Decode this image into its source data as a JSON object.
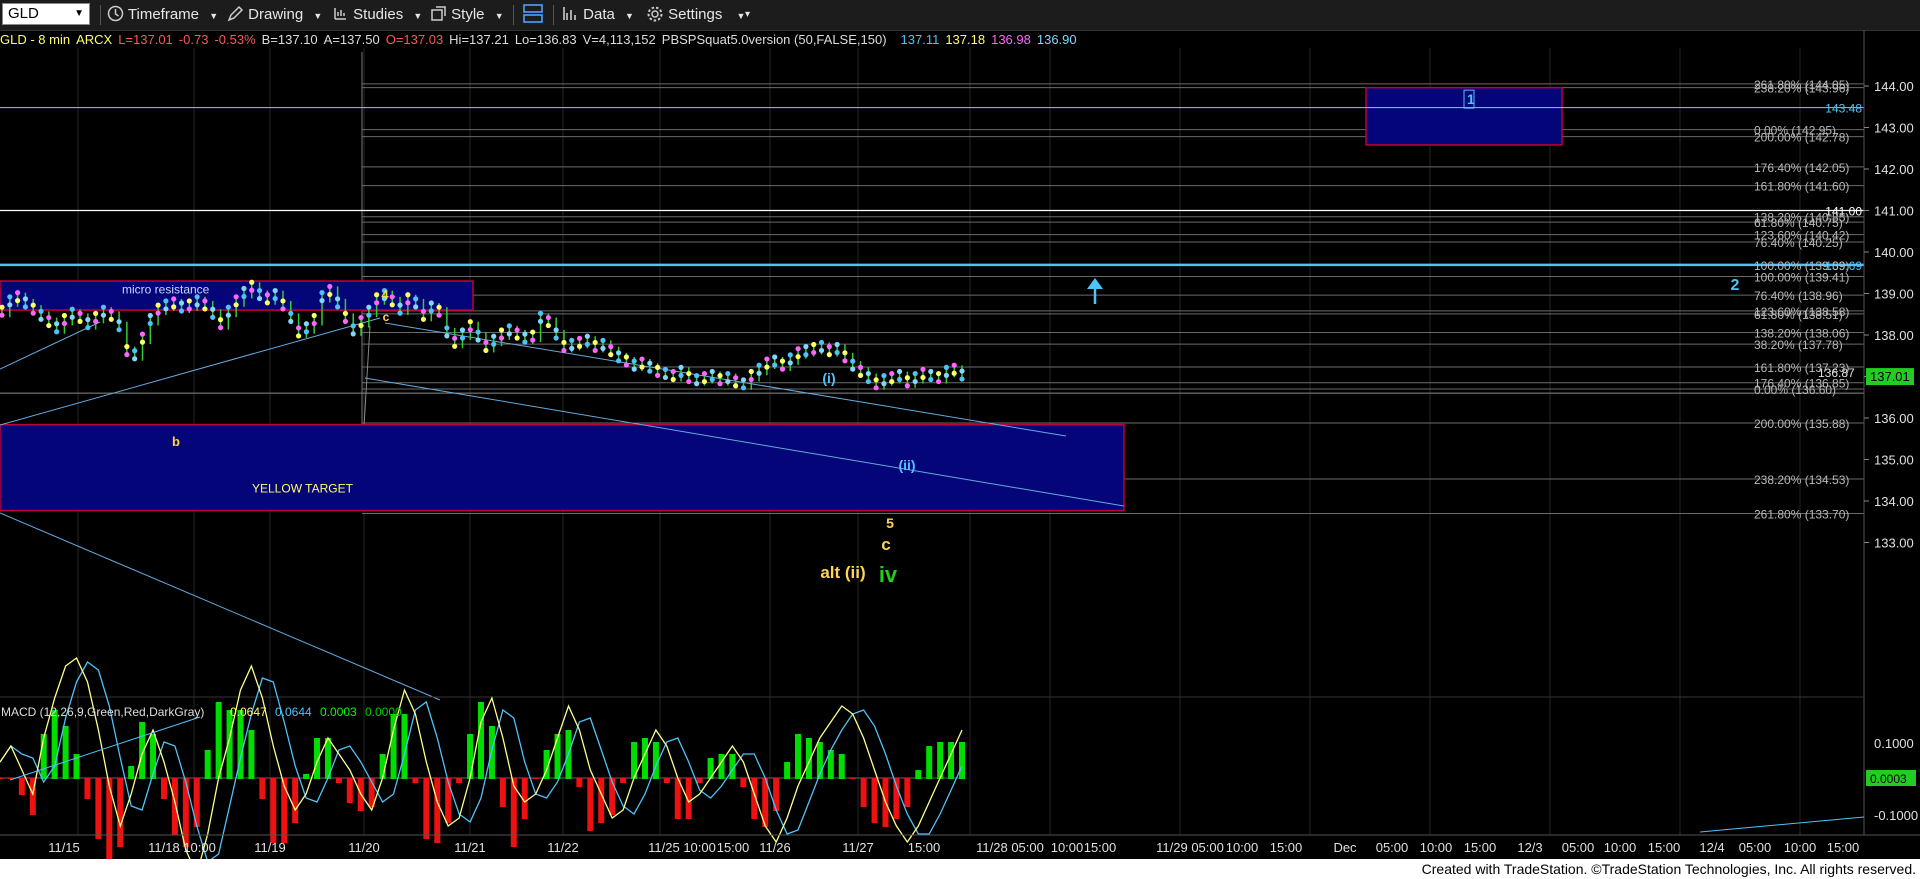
{
  "toolbar": {
    "symbol": "GLD",
    "timeframe": "Timeframe",
    "drawing": "Drawing",
    "studies": "Studies",
    "style": "Style",
    "data": "Data",
    "settings": "Settings"
  },
  "infobar": {
    "symbol": "GLD - 8 min",
    "exchange": "ARCX",
    "last": "L=137.01",
    "change": "-0.73",
    "change_pct": "-0.53%",
    "bid": "B=137.10",
    "ask": "A=137.50",
    "open": "O=137.03",
    "high": "Hi=137.21",
    "low": "Lo=136.83",
    "volume": "V=4,113,152",
    "study": "PBSPSquat5.0version (50,FALSE,150)",
    "study_vals": [
      {
        "text": "137.11",
        "color": "#4fc3f7"
      },
      {
        "text": "137.18",
        "color": "#ffff66"
      },
      {
        "text": "136.98",
        "color": "#ff66ff"
      },
      {
        "text": "136.90",
        "color": "#80d8ff"
      }
    ]
  },
  "macd": {
    "label": "MACD (12,26,9,Green,Red,DarkGray)",
    "vals": [
      {
        "text": "0.0647",
        "color": "#ffff66"
      },
      {
        "text": "0.0644",
        "color": "#4fc3f7"
      },
      {
        "text": "0.0003",
        "color": "#00ff00"
      },
      {
        "text": "0.0000",
        "color": "#00cc00"
      }
    ],
    "axis": [
      "0.1000",
      "-0.1000"
    ],
    "current": "0.0003"
  },
  "chart_data": {
    "type": "candlestick",
    "y_axis": {
      "min": 132.5,
      "max": 144.3,
      "ticks": [
        144.0,
        143.0,
        142.0,
        141.0,
        140.0,
        139.0,
        138.0,
        137.0,
        136.0,
        135.0,
        134.0,
        133.0
      ]
    },
    "x_labels": [
      "11/15",
      "11/18 10:00",
      "11/19",
      "11/20",
      "11/21",
      "11/22",
      "11/25 10:00",
      "15:00",
      "11/26",
      "11/27",
      "15:00",
      "11/28 05:00",
      "10:00",
      "15:00",
      "11/29 05:00",
      "10:00",
      "15:00",
      "Dec",
      "05:00",
      "10:00",
      "15:00",
      "12/3",
      "05:00",
      "10:00",
      "15:00",
      "12/4",
      "05:00",
      "10:00",
      "15:00"
    ],
    "last_price": "137.01",
    "marked_price": "136.87",
    "horizontal_levels": [
      {
        "label": "143.48",
        "value": 143.48,
        "color": "#4fc3f7"
      },
      {
        "label": "141.00",
        "value": 141.0,
        "color": "#ffffff"
      },
      {
        "label": "139.69",
        "value": 139.69,
        "color": "#4fc3f7"
      }
    ],
    "fib_labels": [
      {
        "text": "261.80% (144.05)",
        "value": 144.05
      },
      {
        "text": "238.20% (143.96)",
        "value": 143.96
      },
      {
        "text": "0.00% (142.95)",
        "value": 142.95
      },
      {
        "text": "200.00% (142.78)",
        "value": 142.78
      },
      {
        "text": "176.40% (142.05)",
        "value": 142.05
      },
      {
        "text": "161.80% (141.60)",
        "value": 141.6
      },
      {
        "text": "138.20% (140.85)",
        "value": 140.85
      },
      {
        "text": "61.80% (140.75)",
        "value": 140.72
      },
      {
        "text": "123.60% (140.42)",
        "value": 140.42
      },
      {
        "text": "76.40% (140.25)",
        "value": 140.24
      },
      {
        "text": "100.00% (139.69)",
        "value": 139.69
      },
      {
        "text": "100.00% (139.41)",
        "value": 139.41
      },
      {
        "text": "76.40% (138.96)",
        "value": 138.96
      },
      {
        "text": "123.60% (138.58)",
        "value": 138.58
      },
      {
        "text": "61.80% (138.51)",
        "value": 138.51
      },
      {
        "text": "138.20% (138.06)",
        "value": 138.06
      },
      {
        "text": "38.20% (137.78)",
        "value": 137.78
      },
      {
        "text": "161.80% (137.23)",
        "value": 137.23
      },
      {
        "text": "176.40% (136.85)",
        "value": 136.85
      },
      {
        "text": "0.00% (136.60)",
        "value": 136.7
      },
      {
        "text": "200.00% (135.88)",
        "value": 135.88
      },
      {
        "text": "238.20% (134.53)",
        "value": 134.53
      },
      {
        "text": "261.80% (133.70)",
        "value": 133.7
      }
    ],
    "zones": [
      {
        "label": "micro resistance",
        "top": 139.3,
        "bottom": 138.6
      },
      {
        "label": "YELLOW TARGET",
        "top": 135.84,
        "bottom": 133.77
      },
      {
        "label": "1",
        "top": 143.96,
        "bottom": 142.58
      }
    ],
    "wave_labels": [
      {
        "text": "4",
        "color": "#ffd54f"
      },
      {
        "text": "c",
        "color": "#ffd54f"
      },
      {
        "text": "b",
        "color": "#ffd54f"
      },
      {
        "text": "(i)",
        "color": "#4fc3f7"
      },
      {
        "text": "(ii)",
        "color": "#4fc3f7"
      },
      {
        "text": "5",
        "color": "#ffd54f"
      },
      {
        "text": "c",
        "color": "#ffd54f"
      },
      {
        "text": "alt (ii)",
        "color": "#ffd54f"
      },
      {
        "text": "iv",
        "color": "#22cc22"
      },
      {
        "text": "2",
        "color": "#4fc3f7"
      }
    ],
    "price_series": [
      138.55,
      138.8,
      138.9,
      138.75,
      138.6,
      138.45,
      138.3,
      138.15,
      138.35,
      138.5,
      138.4,
      138.25,
      138.4,
      138.55,
      138.45,
      138.2,
      137.6,
      137.5,
      137.9,
      138.35,
      138.6,
      138.7,
      138.75,
      138.65,
      138.7,
      138.8,
      138.7,
      138.5,
      138.25,
      138.55,
      138.8,
      139.0,
      139.15,
      138.95,
      138.85,
      138.95,
      138.7,
      138.4,
      138.05,
      138.15,
      138.35,
      138.9,
      139.05,
      138.75,
      138.4,
      138.1,
      138.3,
      138.55,
      138.85,
      138.95,
      138.8,
      138.6,
      138.85,
      138.75,
      138.45,
      138.65,
      138.55,
      138.05,
      137.8,
      138.0,
      138.2,
      137.95,
      137.7,
      137.85,
      138.0,
      138.1,
      138.0,
      137.9,
      137.95,
      138.4,
      138.3,
      138.0,
      137.7,
      137.75,
      137.8,
      137.85,
      137.7,
      137.75,
      137.6,
      137.45,
      137.35,
      137.25,
      137.3,
      137.2,
      137.1,
      137.05,
      137.0,
      137.1,
      136.95,
      136.9,
      136.95,
      137.0,
      136.9,
      136.95,
      136.85,
      136.8,
      137.0,
      137.15,
      137.3,
      137.35,
      137.25,
      137.4,
      137.55,
      137.6,
      137.65,
      137.7,
      137.6,
      137.65,
      137.45,
      137.25,
      137.1,
      136.95,
      136.8,
      136.9,
      136.95,
      137.0,
      136.85,
      136.95,
      137.05,
      137.0,
      136.95,
      137.1,
      137.15,
      137.01
    ],
    "macd_series": [
      0.02,
      0.04,
      0.01,
      -0.02,
      0.05,
      0.1,
      0.14,
      0.15,
      0.12,
      0.06,
      -0.01,
      -0.06,
      -0.02,
      0.03,
      0.06,
      0.02,
      -0.03,
      -0.09,
      -0.12,
      -0.07,
      0.0,
      0.05,
      0.11,
      0.14,
      0.1,
      0.04,
      -0.01,
      -0.04,
      -0.02,
      0.02,
      0.05,
      0.03,
      0.01,
      -0.02,
      -0.04,
      0.0,
      0.06,
      0.11,
      0.08,
      0.02,
      -0.03,
      -0.06,
      -0.05,
      0.0,
      0.07,
      0.1,
      0.05,
      -0.01,
      -0.03,
      -0.02,
      0.01,
      0.05,
      0.09,
      0.06,
      0.01,
      -0.02,
      -0.05,
      -0.04,
      0.0,
      0.03,
      0.06,
      0.04,
      0.0,
      -0.03,
      -0.02,
      0.0,
      0.02,
      0.04,
      0.02,
      -0.02,
      -0.06,
      -0.08,
      -0.05,
      -0.01,
      0.02,
      0.05,
      0.07,
      0.09,
      0.08,
      0.05,
      0.01,
      -0.03,
      -0.06,
      -0.08,
      -0.06,
      -0.03,
      0.0,
      0.03,
      0.06
    ]
  },
  "footer": "Created with TradeStation. ©TradeStation Technologies, Inc. All rights reserved."
}
